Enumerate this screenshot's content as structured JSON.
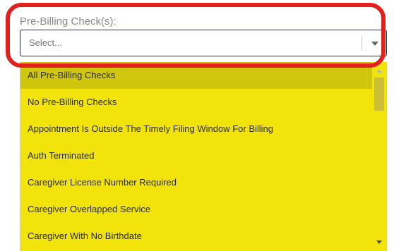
{
  "field": {
    "label": "Pre-Billing Check(s):",
    "placeholder": "Select..."
  },
  "dropdown": {
    "options": [
      "All Pre-Billing Checks",
      "No Pre-Billing Checks",
      "Appointment Is Outside The Timely Filing Window For Billing",
      "Auth Terminated",
      "Caregiver License Number Required",
      "Caregiver Overlapped Service",
      "Caregiver With No Birthdate"
    ],
    "active_index": 0,
    "scroll_position": 0.1
  },
  "colors": {
    "highlight_ring": "#e2201c",
    "menu_background": "#f2e40a",
    "active_option": "#cfc60d"
  },
  "icons": {
    "dropdown_arrow": "chevron-down-icon",
    "scroll_up": "scroll-up-arrow-icon",
    "scroll_down": "scroll-down-arrow-icon"
  }
}
